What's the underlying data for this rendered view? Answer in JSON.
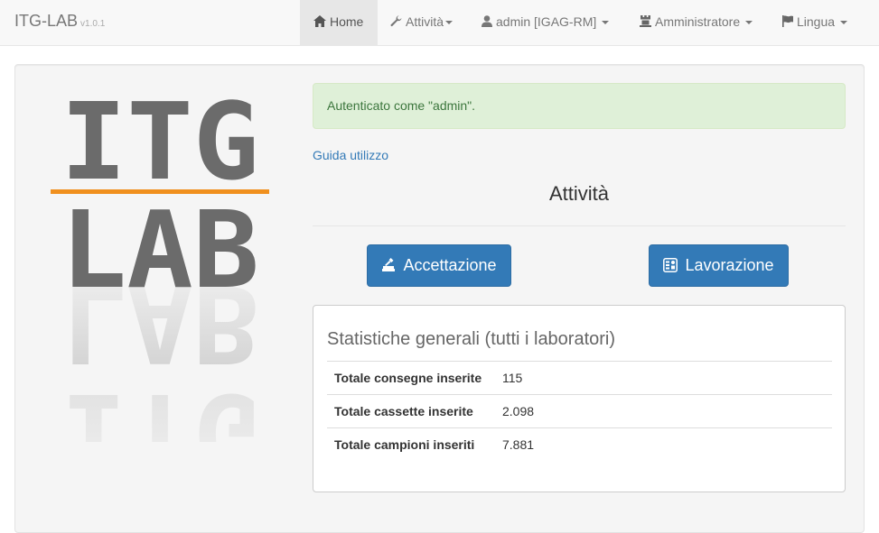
{
  "brand": {
    "name": "ITG-LAB",
    "version": "v1.0.1"
  },
  "nav": {
    "home": "Home",
    "attivita": "Attività",
    "user": "admin [IGAG-RM]",
    "admin": "Amministratore",
    "lingua": "Lingua"
  },
  "logo": {
    "line1": "ITG",
    "line2": "LAB",
    "accent": "#f0901e",
    "text_color": "#6b6b6b"
  },
  "alert": {
    "text": "Autenticato come \"admin\"."
  },
  "guide_link": "Guida utilizzo",
  "section_title": "Attività",
  "buttons": {
    "accettazione": "Accettazione",
    "lavorazione": "Lavorazione"
  },
  "stats": {
    "title": "Statistiche generali (tutti i laboratori)",
    "rows": [
      {
        "label": "Totale consegne inserite",
        "value": "115"
      },
      {
        "label": "Totale cassette inserite",
        "value": "2.098"
      },
      {
        "label": "Totale campioni inseriti",
        "value": "7.881"
      }
    ]
  },
  "colors": {
    "primary": "#337ab7",
    "success_bg": "#dff0d8",
    "success_text": "#3c763d"
  }
}
